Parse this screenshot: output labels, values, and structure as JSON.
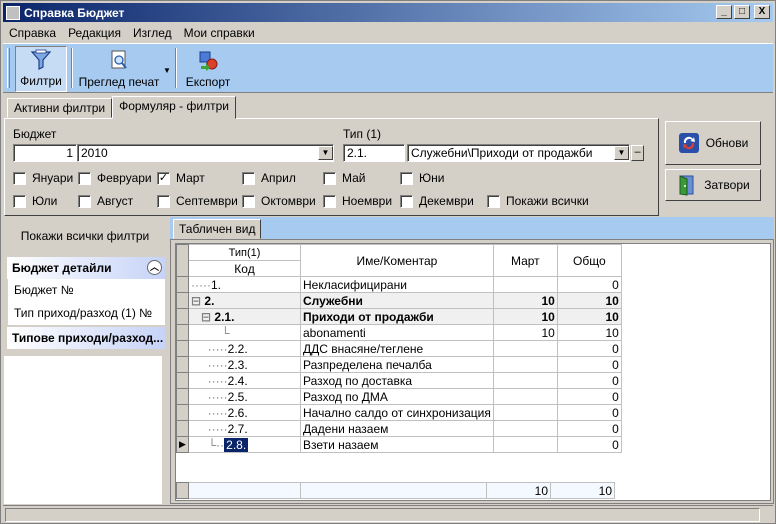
{
  "window": {
    "title": "Справка Бюджет",
    "minimize": "_",
    "maximize": "□",
    "close": "X"
  },
  "menu": [
    "Справка",
    "Редакция",
    "Изглед",
    "Мои справки"
  ],
  "toolbar": {
    "filters": "Филтри",
    "preview": "Преглед печат",
    "export": "Експорт"
  },
  "tabs": [
    "Активни филтри",
    "Формуляр - филтри"
  ],
  "form": {
    "budget_label": "Бюджет",
    "budget_id": "1",
    "budget_value": "2010",
    "type_label": "Тип (1)",
    "type_code": "2.1.",
    "type_value": "Служебни\\Приходи от продажби",
    "months": [
      {
        "label": "Януари",
        "checked": ""
      },
      {
        "label": "Февруари",
        "checked": ""
      },
      {
        "label": "Март",
        "checked": "✓"
      },
      {
        "label": "Април",
        "checked": ""
      },
      {
        "label": "Май",
        "checked": ""
      },
      {
        "label": "Юни",
        "checked": ""
      },
      {
        "label": "Юли",
        "checked": ""
      },
      {
        "label": "Август",
        "checked": ""
      },
      {
        "label": "Септември",
        "checked": ""
      },
      {
        "label": "Октомври",
        "checked": ""
      },
      {
        "label": "Ноември",
        "checked": ""
      },
      {
        "label": "Декември",
        "checked": ""
      }
    ],
    "show_all": "Покажи всички",
    "refresh": "Обнови",
    "close": "Затвори"
  },
  "left": {
    "show_all_filters": "Покажи всички филтри",
    "group1": {
      "title": "Бюджет детайли",
      "items": [
        "Бюджет №",
        "Тип приход/разход (1) №"
      ]
    },
    "group2": {
      "title": "Типове приходи/разход..."
    }
  },
  "grid": {
    "tab": "Табличен вид",
    "header": {
      "type": "Тип(1)",
      "code": "Код",
      "name": "Име/Коментар",
      "march": "Март",
      "total": "Общо"
    },
    "rows": [
      {
        "code": "1.",
        "name": "Некласифицирани",
        "march": "",
        "total": "0"
      },
      {
        "code": "2.",
        "name": "Служебни",
        "march": "10",
        "total": "10"
      },
      {
        "code": "2.1.",
        "name": "Приходи от продажби",
        "march": "10",
        "total": "10"
      },
      {
        "code": "",
        "name": "abonamenti",
        "march": "10",
        "total": "10"
      },
      {
        "code": "2.2.",
        "name": "ДДС внасяне/теглене",
        "march": "",
        "total": "0"
      },
      {
        "code": "2.3.",
        "name": "Разпределена печалба",
        "march": "",
        "total": "0"
      },
      {
        "code": "2.4.",
        "name": "Разход по доставка",
        "march": "",
        "total": "0"
      },
      {
        "code": "2.5.",
        "name": "Разход по ДМА",
        "march": "",
        "total": "0"
      },
      {
        "code": "2.6.",
        "name": "Начално салдо от синхронизация",
        "march": "",
        "total": "0"
      },
      {
        "code": "2.7.",
        "name": "Дадени назаем",
        "march": "",
        "total": "0"
      },
      {
        "code": "2.8.",
        "name": "Взети назаем",
        "march": "",
        "total": "0"
      }
    ],
    "footer": {
      "march": "10",
      "total": "10"
    }
  }
}
